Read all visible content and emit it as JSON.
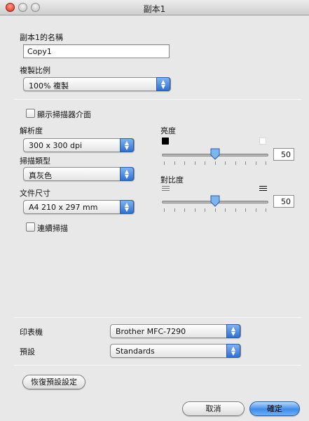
{
  "window": {
    "title": "副本1"
  },
  "copy_name": {
    "label": "副本1的名稱",
    "value": "Copy1"
  },
  "scale": {
    "label": "複製比例",
    "selected": "100% 複製"
  },
  "show_scanner_ui": {
    "label": "顯示掃描器介面",
    "checked": false
  },
  "resolution": {
    "label": "解析度",
    "selected": "300 x 300 dpi"
  },
  "scan_type": {
    "label": "掃描類型",
    "selected": "真灰色"
  },
  "document_size": {
    "label": "文件尺寸",
    "selected": "A4 210 x 297 mm"
  },
  "continuous_scan": {
    "label": "連續掃描",
    "checked": false
  },
  "brightness": {
    "label": "亮度",
    "value": "50",
    "level_percent": 50
  },
  "contrast": {
    "label": "對比度",
    "value": "50",
    "level_percent": 50
  },
  "printer": {
    "label": "印表機",
    "selected": "Brother MFC-7290"
  },
  "preset": {
    "label": "預設",
    "selected": "Standards"
  },
  "buttons": {
    "restore_defaults": "恢復預設設定",
    "cancel": "取消",
    "ok": "確定"
  },
  "colors": {
    "accent": "#3f8ce9",
    "close_button": "#d72b16"
  }
}
